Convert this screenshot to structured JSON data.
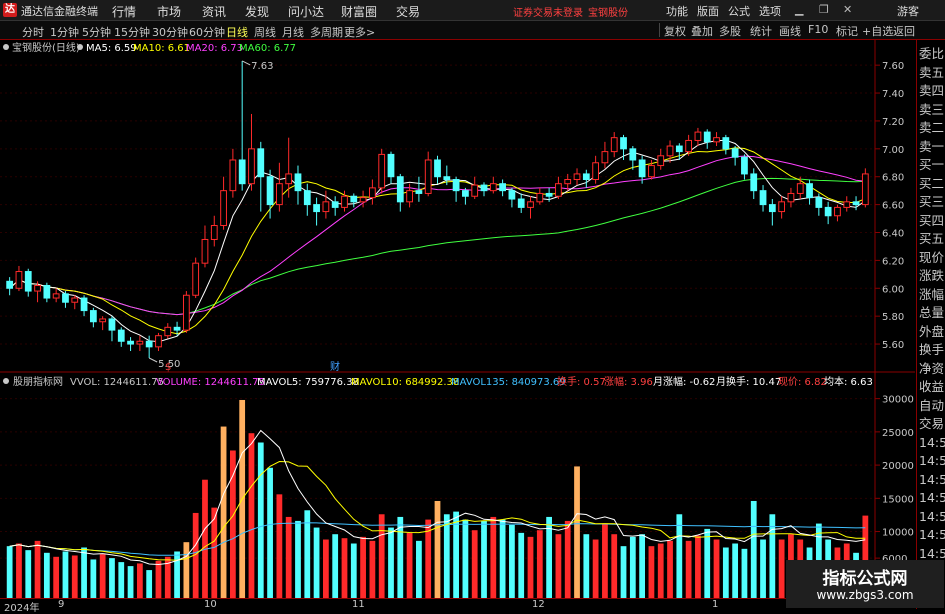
{
  "app": {
    "title": "通达信金融终端",
    "menus": [
      "行情",
      "市场",
      "资讯",
      "发现",
      "问小达",
      "财富圈",
      "交易"
    ],
    "notice": "证券交易未登录",
    "notice_stock": "宝钢股份",
    "right_menus": [
      "功能",
      "版面",
      "公式",
      "选项"
    ],
    "user": "游客"
  },
  "periods": [
    "分时",
    "1分钟",
    "5分钟",
    "15分钟",
    "30分钟",
    "60分钟",
    "日线",
    "周线",
    "月线",
    "多周期",
    "更多>"
  ],
  "active_period": "日线",
  "tools": [
    "复权",
    "叠加",
    "多股",
    "统计",
    "画线",
    "F10",
    "标记",
    "+自选",
    "返回"
  ],
  "price_panel": {
    "stock_label": "宝钢股份(日线)",
    "ma_labels": [
      {
        "text": "MA5: 6.59",
        "color": "#ffffff"
      },
      {
        "text": "MA10: 6.61",
        "color": "#ffff00"
      },
      {
        "text": "MA20: 6.73",
        "color": "#ff40ff"
      },
      {
        "text": "MA60: 6.77",
        "color": "#40ff40"
      }
    ],
    "high_label": "7.63",
    "low_label": "5.50",
    "axis_ticks": [
      "7.60",
      "7.40",
      "7.20",
      "7.00",
      "6.80",
      "6.60",
      "6.40",
      "6.20",
      "6.00",
      "5.80",
      "5.60"
    ],
    "event_markers": [
      {
        "text": "$",
        "color": "#ff4040"
      },
      {
        "text": "财",
        "color": "#40a0ff"
      }
    ]
  },
  "volume_panel": {
    "indicator_name": "股朋指标网",
    "stats": [
      {
        "text": "VVOL: 1244611.75",
        "color": "#c8c8c8"
      },
      {
        "text": "VOLUME: 1244611.75",
        "color": "#ff40ff"
      },
      {
        "text": "MAVOL5: 759776.38",
        "color": "#ffffff"
      },
      {
        "text": "MAVOL10: 684992.38",
        "color": "#ffff00"
      },
      {
        "text": "MAVOL135: 840973.69",
        "color": "#40c0ff"
      },
      {
        "text": "换手: 0.57",
        "color": "#ff4040"
      },
      {
        "text": "涨幅: 3.96",
        "color": "#ff4040"
      },
      {
        "text": "月涨幅: -0.62",
        "color": "#ffffff"
      },
      {
        "text": "月换手: 10.47",
        "color": "#ffffff"
      },
      {
        "text": "现价: 6.82",
        "color": "#ff4040"
      },
      {
        "text": "均本: 6.63",
        "color": "#ffffff"
      }
    ],
    "axis_ticks": [
      "30000",
      "25000",
      "20000",
      "15000",
      "10000",
      "6000"
    ]
  },
  "sidebar": [
    "委比",
    "卖五",
    "卖四",
    "卖三",
    "卖二",
    "卖一",
    "买一",
    "买二",
    "买三",
    "买四",
    "买五",
    "现价",
    "涨跌",
    "涨幅",
    "总量",
    "外盘",
    "换手",
    "净资",
    "收益",
    "自动",
    "交易",
    "14:56",
    "14:56",
    "14:56",
    "14:56",
    "14:56",
    "14:56",
    "14:56"
  ],
  "date_axis": [
    "2024年",
    "9",
    "10",
    "11",
    "12",
    "1"
  ],
  "watermark": {
    "title": "指标公式网",
    "url": "www.zbgs3.com"
  },
  "colors": {
    "up": "#ff2a2a",
    "down": "#52ffff",
    "highlight": "#ffb060"
  },
  "chart_data": {
    "type": "candlestick",
    "price_ylim": [
      5.5,
      7.68
    ],
    "volume_ylim": [
      0,
      31000
    ],
    "candles": [
      [
        6.05,
        6.0,
        6.08,
        5.95
      ],
      [
        6.0,
        6.12,
        6.16,
        5.98
      ],
      [
        6.12,
        5.98,
        6.14,
        5.94
      ],
      [
        5.98,
        6.02,
        6.05,
        5.9
      ],
      [
        6.02,
        5.93,
        6.04,
        5.9
      ],
      [
        5.93,
        5.96,
        6.0,
        5.9
      ],
      [
        5.96,
        5.9,
        5.98,
        5.86
      ],
      [
        5.9,
        5.93,
        5.95,
        5.85
      ],
      [
        5.93,
        5.84,
        5.95,
        5.8
      ],
      [
        5.84,
        5.76,
        5.86,
        5.72
      ],
      [
        5.76,
        5.78,
        5.8,
        5.7
      ],
      [
        5.78,
        5.7,
        5.8,
        5.62
      ],
      [
        5.7,
        5.62,
        5.72,
        5.58
      ],
      [
        5.62,
        5.6,
        5.65,
        5.55
      ],
      [
        5.6,
        5.62,
        5.66,
        5.55
      ],
      [
        5.62,
        5.58,
        5.66,
        5.5
      ],
      [
        5.58,
        5.66,
        5.68,
        5.55
      ],
      [
        5.66,
        5.72,
        5.75,
        5.64
      ],
      [
        5.72,
        5.7,
        5.76,
        5.66
      ],
      [
        5.7,
        5.95,
        5.98,
        5.68
      ],
      [
        5.95,
        6.18,
        6.22,
        5.93
      ],
      [
        6.18,
        6.35,
        6.45,
        6.15
      ],
      [
        6.35,
        6.45,
        6.52,
        6.3
      ],
      [
        6.45,
        6.7,
        6.8,
        6.42
      ],
      [
        6.7,
        6.92,
        7.0,
        6.65
      ],
      [
        6.92,
        6.75,
        7.63,
        6.7
      ],
      [
        6.75,
        7.0,
        7.25,
        6.7
      ],
      [
        7.0,
        6.8,
        7.05,
        6.55
      ],
      [
        6.8,
        6.6,
        6.85,
        6.5
      ],
      [
        6.6,
        6.75,
        6.9,
        6.55
      ],
      [
        6.75,
        6.82,
        7.08,
        6.65
      ],
      [
        6.82,
        6.7,
        6.88,
        6.6
      ],
      [
        6.7,
        6.6,
        6.75,
        6.52
      ],
      [
        6.6,
        6.55,
        6.65,
        6.45
      ],
      [
        6.55,
        6.62,
        6.7,
        6.5
      ],
      [
        6.62,
        6.58,
        6.66,
        6.52
      ],
      [
        6.58,
        6.66,
        6.7,
        6.55
      ],
      [
        6.66,
        6.62,
        6.68,
        6.58
      ],
      [
        6.62,
        6.65,
        6.7,
        6.58
      ],
      [
        6.65,
        6.72,
        6.78,
        6.6
      ],
      [
        6.72,
        6.96,
        7.0,
        6.68
      ],
      [
        6.96,
        6.8,
        6.98,
        6.75
      ],
      [
        6.8,
        6.62,
        6.82,
        6.55
      ],
      [
        6.62,
        6.7,
        6.75,
        6.58
      ],
      [
        6.7,
        6.68,
        6.8,
        6.62
      ],
      [
        6.68,
        6.92,
        6.98,
        6.66
      ],
      [
        6.92,
        6.8,
        6.95,
        6.75
      ],
      [
        6.8,
        6.78,
        6.88,
        6.74
      ],
      [
        6.78,
        6.7,
        6.8,
        6.62
      ],
      [
        6.7,
        6.66,
        6.72,
        6.6
      ],
      [
        6.66,
        6.74,
        6.8,
        6.64
      ],
      [
        6.74,
        6.7,
        6.76,
        6.66
      ],
      [
        6.7,
        6.75,
        6.8,
        6.68
      ],
      [
        6.75,
        6.7,
        6.78,
        6.66
      ],
      [
        6.7,
        6.64,
        6.72,
        6.58
      ],
      [
        6.64,
        6.58,
        6.68,
        6.54
      ],
      [
        6.58,
        6.62,
        6.66,
        6.5
      ],
      [
        6.62,
        6.68,
        6.72,
        6.6
      ],
      [
        6.68,
        6.66,
        6.72,
        6.62
      ],
      [
        6.66,
        6.75,
        6.8,
        6.64
      ],
      [
        6.75,
        6.78,
        6.82,
        6.7
      ],
      [
        6.78,
        6.82,
        6.86,
        6.74
      ],
      [
        6.82,
        6.78,
        6.85,
        6.72
      ],
      [
        6.78,
        6.9,
        6.95,
        6.75
      ],
      [
        6.9,
        6.98,
        7.05,
        6.86
      ],
      [
        6.98,
        7.08,
        7.12,
        6.94
      ],
      [
        7.08,
        7.0,
        7.1,
        6.92
      ],
      [
        7.0,
        6.92,
        7.02,
        6.85
      ],
      [
        6.92,
        6.8,
        6.95,
        6.75
      ],
      [
        6.8,
        6.88,
        6.92,
        6.78
      ],
      [
        6.88,
        6.95,
        7.0,
        6.85
      ],
      [
        6.95,
        7.02,
        7.06,
        6.9
      ],
      [
        7.02,
        6.98,
        7.04,
        6.92
      ],
      [
        6.98,
        7.06,
        7.1,
        6.95
      ],
      [
        7.06,
        7.12,
        7.15,
        7.02
      ],
      [
        7.12,
        7.05,
        7.14,
        7.0
      ],
      [
        7.05,
        7.08,
        7.12,
        7.02
      ],
      [
        7.08,
        7.0,
        7.1,
        6.96
      ],
      [
        7.0,
        6.94,
        7.02,
        6.88
      ],
      [
        6.94,
        6.82,
        6.96,
        6.78
      ],
      [
        6.82,
        6.7,
        6.86,
        6.64
      ],
      [
        6.7,
        6.6,
        6.74,
        6.55
      ],
      [
        6.6,
        6.55,
        6.64,
        6.45
      ],
      [
        6.55,
        6.62,
        6.66,
        6.5
      ],
      [
        6.62,
        6.68,
        6.72,
        6.58
      ],
      [
        6.68,
        6.75,
        6.8,
        6.64
      ],
      [
        6.75,
        6.65,
        6.78,
        6.6
      ],
      [
        6.65,
        6.58,
        6.68,
        6.52
      ],
      [
        6.58,
        6.52,
        6.62,
        6.46
      ],
      [
        6.52,
        6.58,
        6.6,
        6.48
      ],
      [
        6.58,
        6.62,
        6.66,
        6.55
      ],
      [
        6.62,
        6.6,
        6.66,
        6.56
      ],
      [
        6.6,
        6.82,
        6.86,
        6.58
      ]
    ],
    "volume": [
      7800,
      8200,
      7200,
      8600,
      6800,
      6200,
      7000,
      6400,
      7600,
      5800,
      6600,
      6000,
      5400,
      4800,
      5200,
      4200,
      5600,
      6200,
      7000,
      8400,
      12800,
      17800,
      13600,
      25800,
      22200,
      29800,
      24800,
      23400,
      19600,
      15600,
      12200,
      11600,
      13200,
      10600,
      8800,
      9600,
      9000,
      8200,
      9200,
      8600,
      12600,
      10600,
      12200,
      9800,
      8600,
      11800,
      14600,
      12600,
      13000,
      11800,
      10200,
      11600,
      12200,
      11800,
      11000,
      9800,
      9200,
      10200,
      12200,
      9600,
      11600,
      19800,
      9600,
      8800,
      11200,
      9600,
      7800,
      9200,
      9600,
      7800,
      8200,
      8600,
      12600,
      8600,
      9400,
      10400,
      8800,
      7600,
      8200,
      7400,
      14600,
      8800,
      12600,
      8800,
      9600,
      8800,
      7600,
      11200,
      8800,
      7600,
      8200,
      6800,
      12400
    ],
    "volume_highlight": [
      19,
      23,
      25,
      46,
      61
    ],
    "mavol_series_names": [
      "MAVOL5",
      "MAVOL10",
      "MAVOL135"
    ]
  }
}
